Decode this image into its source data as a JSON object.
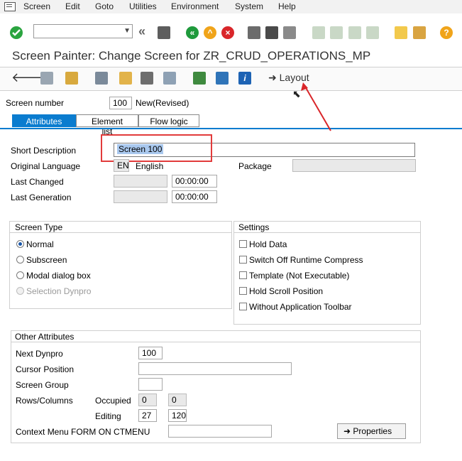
{
  "menu": [
    "Screen",
    "Edit",
    "Goto",
    "Utilities",
    "Environment",
    "System",
    "Help"
  ],
  "title": "Screen Painter: Change Screen for ZR_CRUD_OPERATIONS_MP",
  "toolbar": {
    "layout_label": "Layout",
    "command_field": ""
  },
  "header": {
    "screen_number_label": "Screen number",
    "screen_number": "100",
    "status": "New(Revised)"
  },
  "tabs": [
    "Attributes",
    "Element list",
    "Flow logic"
  ],
  "attributes": {
    "short_description_label": "Short Description",
    "short_description": "Screen 100",
    "original_language_label": "Original Language",
    "original_language_code": "EN",
    "original_language_name": "English",
    "package_label": "Package",
    "package": "",
    "last_changed_label": "Last Changed",
    "last_changed_time": "00:00:00",
    "last_generation_label": "Last Generation",
    "last_generation_time": "00:00:00"
  },
  "screen_type": {
    "title": "Screen Type",
    "options": [
      "Normal",
      "Subscreen",
      "Modal dialog box",
      "Selection Dynpro"
    ],
    "selected": "Normal"
  },
  "settings": {
    "title": "Settings",
    "options": [
      "Hold Data",
      "Switch Off Runtime Compress",
      "Template (Not Executable)",
      "Hold Scroll Position",
      "Without Application Toolbar"
    ]
  },
  "other": {
    "title": "Other Attributes",
    "next_dynpro_label": "Next Dynpro",
    "next_dynpro": "100",
    "cursor_position_label": "Cursor Position",
    "cursor_position": "",
    "screen_group_label": "Screen Group",
    "screen_group": "",
    "rows_columns_label": "Rows/Columns",
    "occupied_label": "Occupied",
    "occupied_rows": "0",
    "occupied_cols": "0",
    "editing_label": "Editing",
    "editing_rows": "27",
    "editing_cols": "120",
    "context_menu_label": "Context Menu FORM ON CTMENU",
    "context_menu": "",
    "properties_label": "Properties"
  },
  "colors": {
    "accent": "#0a7ccf",
    "highlight_box": "#e23b3b",
    "arrow": "#d9262a"
  }
}
